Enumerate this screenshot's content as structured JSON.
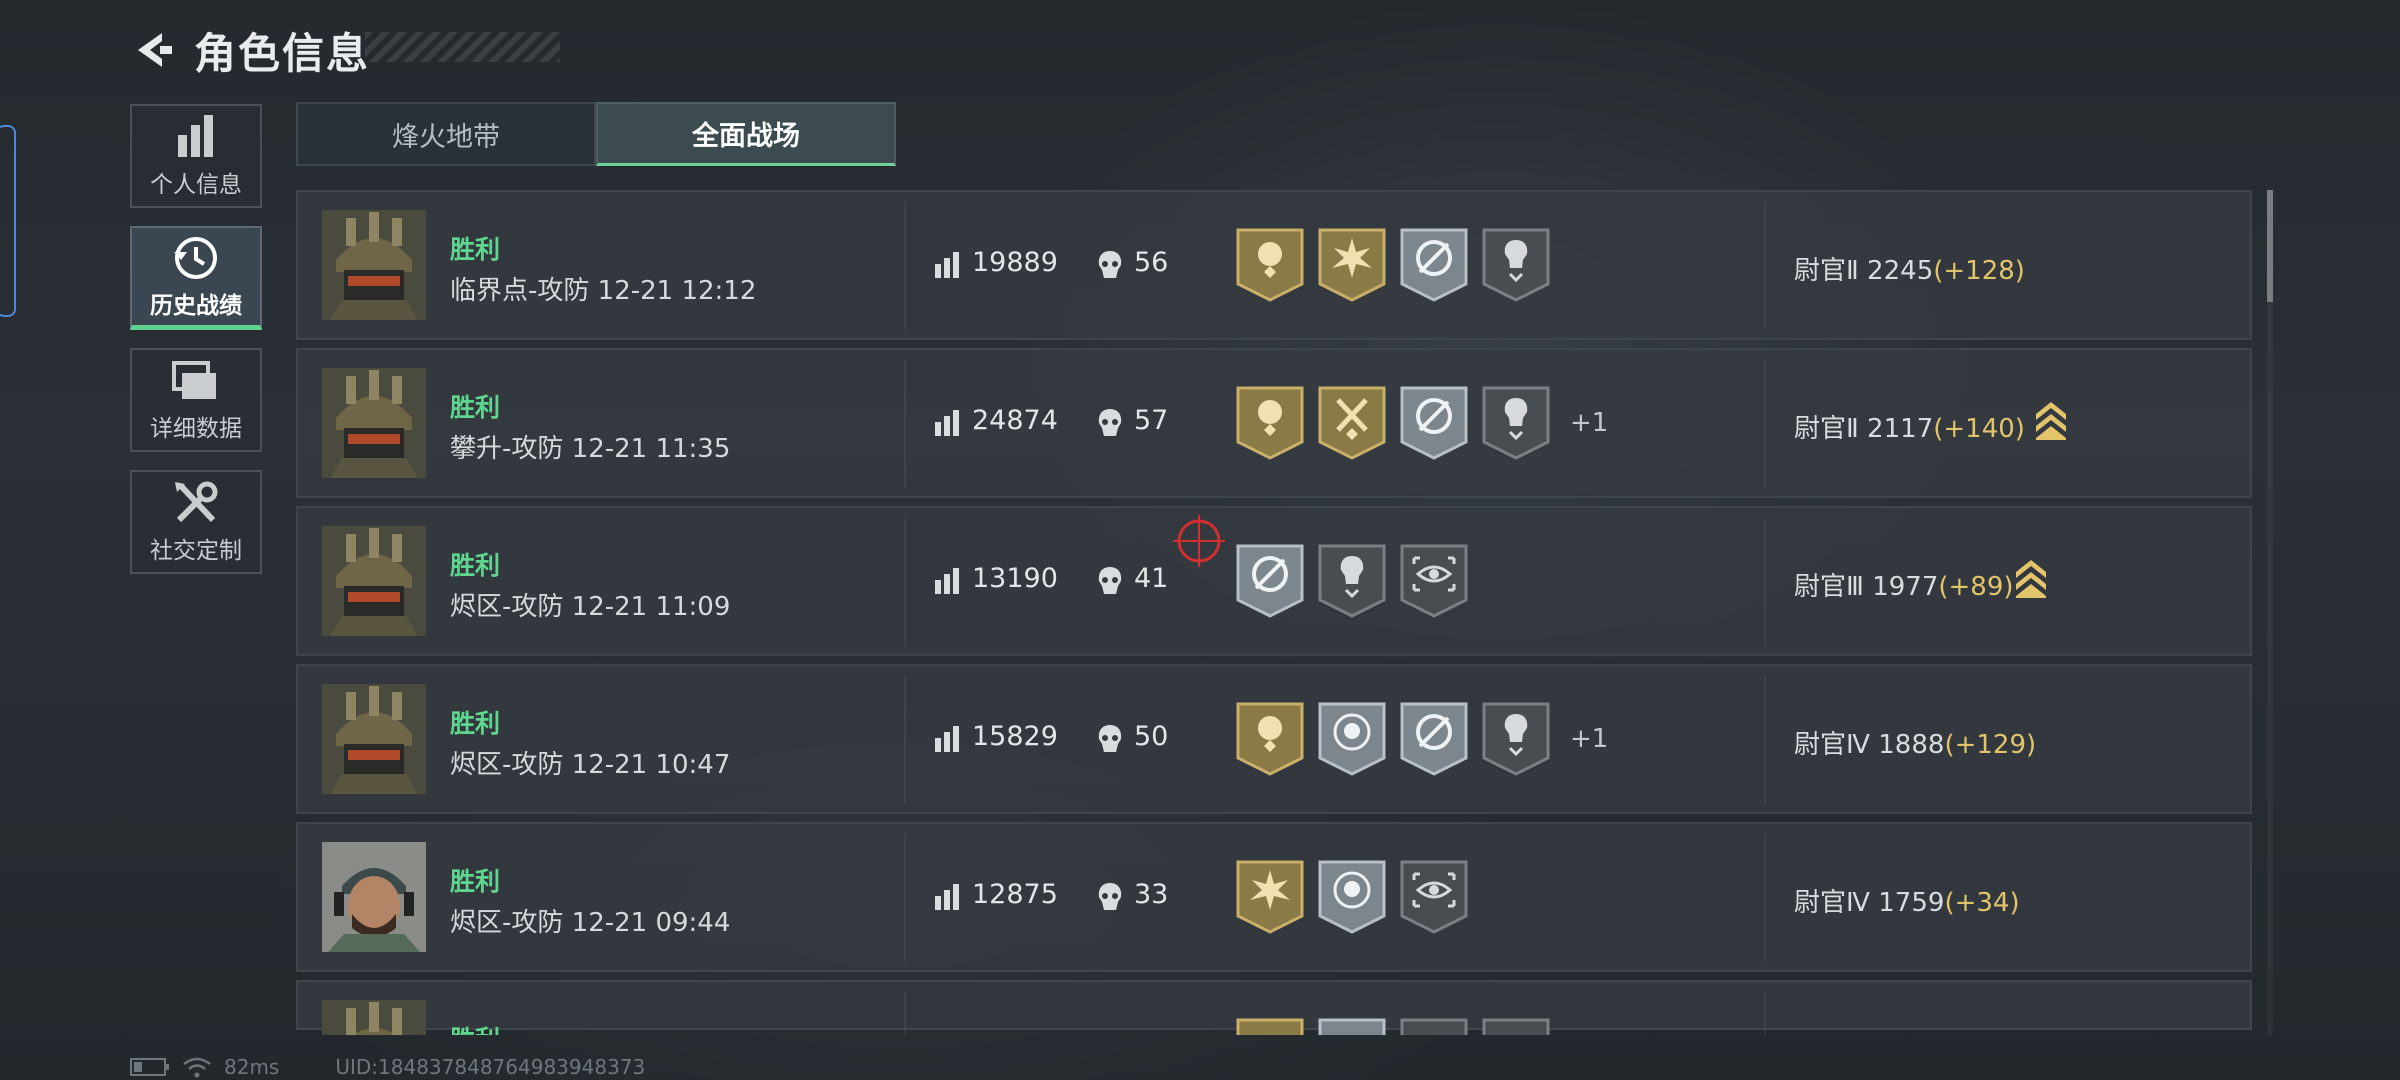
{
  "header": {
    "title": "角色信息"
  },
  "sidebar": {
    "items": [
      {
        "label": "个人信息",
        "active": false
      },
      {
        "label": "历史战绩",
        "active": true
      },
      {
        "label": "详细数据",
        "active": false
      },
      {
        "label": "社交定制",
        "active": false
      }
    ]
  },
  "tabs": [
    {
      "label": "烽火地带",
      "active": false
    },
    {
      "label": "全面战场",
      "active": true
    }
  ],
  "matches": [
    {
      "result": "胜利",
      "map": "临界点-攻防 12-21 12:12",
      "score": "19889",
      "kills": "56",
      "badges": [
        "gold-laurel-badge-icon",
        "gold-burst-badge-icon",
        "silver-target-badge-icon",
        "dark-skull-badge-icon"
      ],
      "extra": "",
      "rank": "尉官Ⅱ 2245",
      "delta": "(+128)",
      "rank_up": false
    },
    {
      "result": "胜利",
      "map": "攀升-攻防 12-21 11:35",
      "score": "24874",
      "kills": "57",
      "badges": [
        "gold-laurel-badge-icon",
        "gold-axes-badge-icon",
        "silver-target-badge-icon",
        "dark-skull-badge-icon"
      ],
      "extra": "+1",
      "rank": "尉官Ⅱ 2117",
      "delta": "(+140)",
      "rank_up": true
    },
    {
      "result": "胜利",
      "map": "烬区-攻防 12-21 11:09",
      "score": "13190",
      "kills": "41",
      "badges": [
        "silver-target-badge-icon",
        "dark-skull-badge-icon",
        "dark-eye-badge-icon"
      ],
      "extra": "",
      "rank": "尉官Ⅲ 1977",
      "delta": "(+89)",
      "rank_up": true
    },
    {
      "result": "胜利",
      "map": "烬区-攻防 12-21 10:47",
      "score": "15829",
      "kills": "50",
      "badges": [
        "gold-laurel-badge-icon",
        "silver-skull-target-badge-icon",
        "silver-target-badge-icon",
        "dark-skull-badge-icon"
      ],
      "extra": "+1",
      "rank": "尉官Ⅳ 1888",
      "delta": "(+129)",
      "rank_up": false
    },
    {
      "result": "胜利",
      "map": "烬区-攻防 12-21 09:44",
      "score": "12875",
      "kills": "33",
      "badges": [
        "gold-burst-badge-icon",
        "silver-skull-target-badge-icon",
        "dark-eye-badge-icon"
      ],
      "extra": "",
      "rank": "尉官Ⅳ 1759",
      "delta": "(+34)",
      "rank_up": false
    },
    {
      "result": "胜利",
      "map": "",
      "score": "",
      "kills": "",
      "badges": [],
      "extra": "",
      "rank": "",
      "delta": "",
      "rank_up": false
    }
  ],
  "status_bar": {
    "ping": "82ms",
    "uid": "UID:18483784876498394837​3"
  },
  "colors": {
    "victory": "#5fd68f",
    "gold": "#e2c46a",
    "active_tab": "#6fd29b"
  }
}
